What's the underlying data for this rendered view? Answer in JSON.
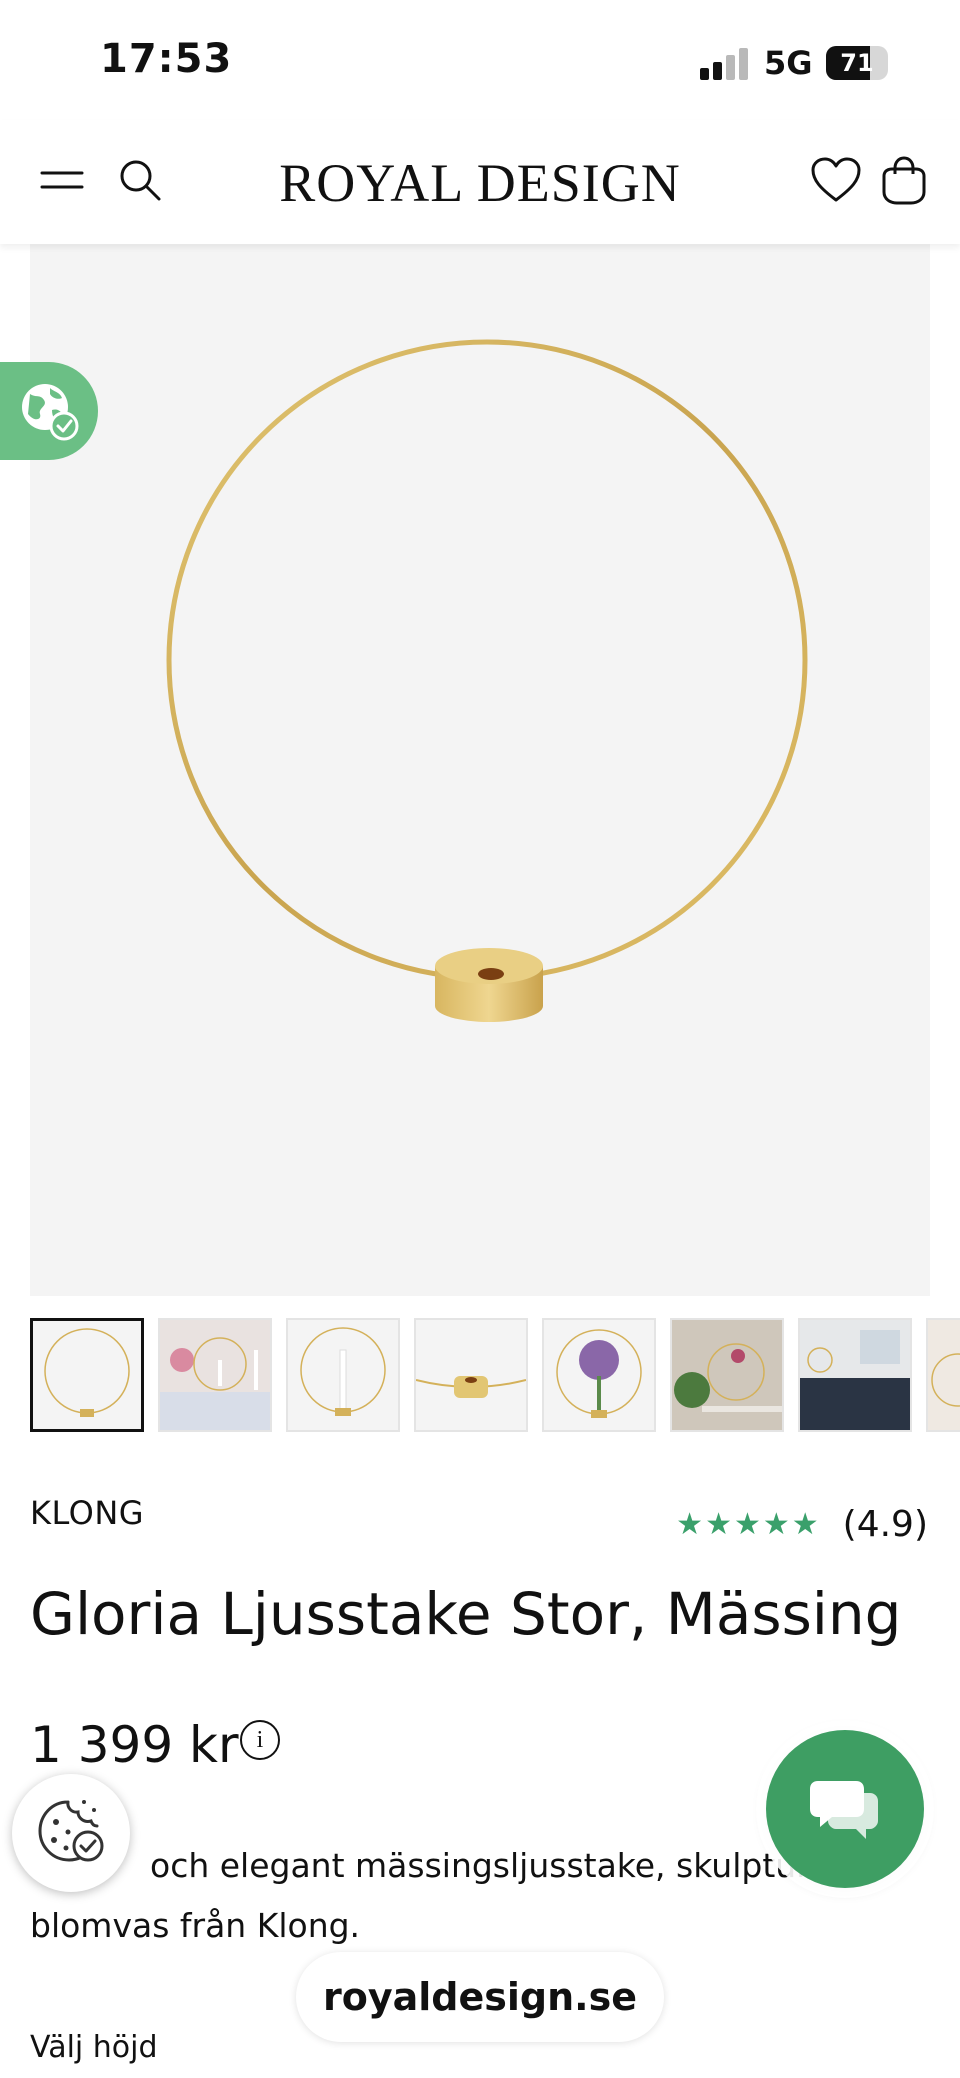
{
  "status_bar": {
    "time": "17:53",
    "network": "5G",
    "battery": "71",
    "battery_level_percent": 71,
    "signal_bars_active": 2
  },
  "header": {
    "brand": "ROYAL DESIGN",
    "icons": [
      "menu-icon",
      "search-icon",
      "wishlist-heart-icon",
      "shopping-bag-icon"
    ]
  },
  "gallery": {
    "main_image_alt": "Gloria Ljusstake Stor, Mässing",
    "product_engraving": "KLONG",
    "thumbnail_count": 8,
    "active_thumbnail": 1
  },
  "product": {
    "brand": "KLONG",
    "rating_stars": "★★★★★",
    "rating": "(4.9)",
    "title": "Gloria Ljusstake Stor, Mässing",
    "price": "1 399 kr",
    "description": "Stor och elegant mässingsljusstake, skulptur och blomvas från Klong.",
    "description_visible": {
      "line1": "och elegant mässingsljusstake, skulptur",
      "line2": "blomvas från Klong."
    },
    "variant_label": "Välj höjd"
  },
  "browser": {
    "url": "royaldesign.se"
  },
  "colors": {
    "accent_green": "#3e9e63",
    "eco_badge_green": "#6bbf85",
    "star_green": "#3aa06b",
    "brass": "#d4b15a"
  }
}
